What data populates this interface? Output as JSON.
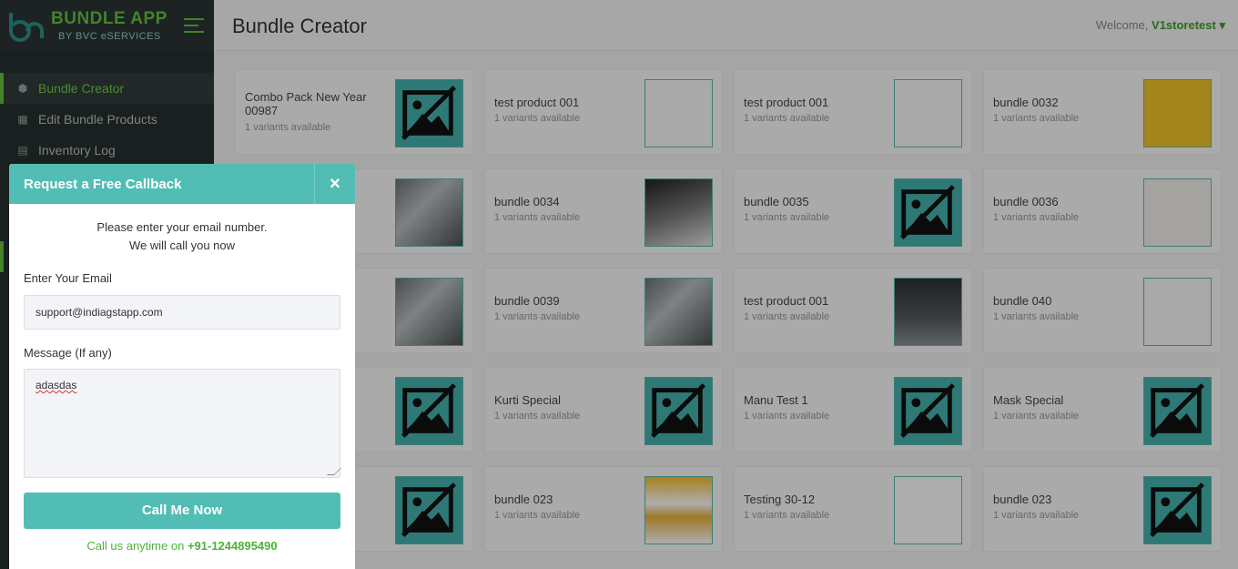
{
  "brand": {
    "title": "BUNDLE APP",
    "subtitle": "BY BVC eSERVICES"
  },
  "header": {
    "title": "Bundle Creator",
    "welcome_prefix": "Welcome,",
    "username": "V1storetest"
  },
  "sidebar": {
    "items": [
      {
        "label": "Bundle Creator",
        "icon": "cube-icon",
        "active": true
      },
      {
        "label": "Edit Bundle Products",
        "icon": "sitemap-icon",
        "active": false
      },
      {
        "label": "Inventory Log",
        "icon": "file-icon",
        "active": false
      }
    ]
  },
  "products": [
    {
      "name": "Combo Pack New Year 00987",
      "variants": "1 variants available",
      "thumb": "placeholder"
    },
    {
      "name": "test product 001",
      "variants": "1 variants available",
      "thumb": "doc"
    },
    {
      "name": "test product 001",
      "variants": "1 variants available",
      "thumb": "doc"
    },
    {
      "name": "bundle 0032",
      "variants": "1 variants available",
      "thumb": "yellow"
    },
    {
      "name": "",
      "variants": "",
      "thumb": "photo"
    },
    {
      "name": "bundle 0034",
      "variants": "1 variants available",
      "thumb": "photo2"
    },
    {
      "name": "bundle 0035",
      "variants": "1 variants available",
      "thumb": "placeholder"
    },
    {
      "name": "bundle 0036",
      "variants": "1 variants available",
      "thumb": "boxes"
    },
    {
      "name": "",
      "variants": "",
      "thumb": "photo"
    },
    {
      "name": "bundle 0039",
      "variants": "1 variants available",
      "thumb": "photo"
    },
    {
      "name": "test product 001",
      "variants": "1 variants available",
      "thumb": "dark"
    },
    {
      "name": "bundle 040",
      "variants": "1 variants available",
      "thumb": "car"
    },
    {
      "name": "",
      "variants": "",
      "thumb": "placeholder"
    },
    {
      "name": "Kurti Special",
      "variants": "1 variants available",
      "thumb": "placeholder"
    },
    {
      "name": "Manu Test 1",
      "variants": "1 variants available",
      "thumb": "placeholder"
    },
    {
      "name": "Mask Special",
      "variants": "1 variants available",
      "thumb": "placeholder"
    },
    {
      "name": "",
      "variants": "",
      "thumb": "placeholder"
    },
    {
      "name": "bundle 023",
      "variants": "1 variants available",
      "thumb": "flyer"
    },
    {
      "name": "Testing 30-12",
      "variants": "1 variants available",
      "thumb": "circle"
    },
    {
      "name": "bundle 023",
      "variants": "1 variants available",
      "thumb": "placeholder"
    }
  ],
  "modal": {
    "title": "Request a Free Callback",
    "close": "×",
    "intro_line1": "Please enter your email number.",
    "intro_line2": "We will call you now",
    "email_label": "Enter Your Email",
    "email_value": "support@indiagstapp.com",
    "message_label": "Message (If any)",
    "message_value": "adasdas",
    "submit": "Call Me Now",
    "call_text": "Call us anytime on",
    "phone": "+91-1244895490"
  },
  "colors": {
    "accent": "#52bdb5",
    "brand_green": "#63c23d",
    "sidebar_bg": "#26302f"
  }
}
